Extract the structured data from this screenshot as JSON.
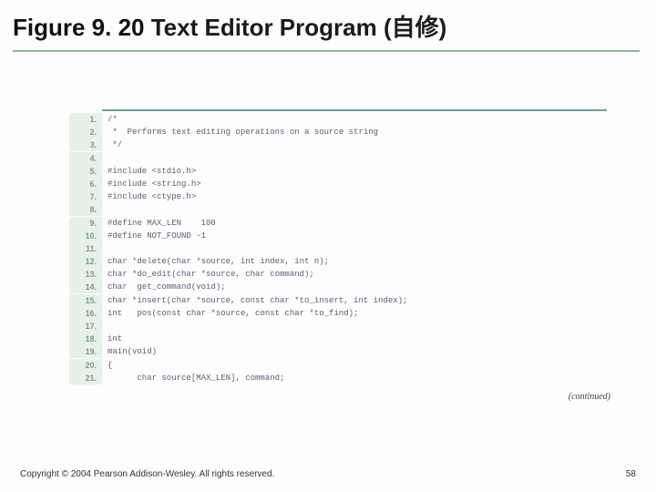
{
  "title": {
    "figure_label": "Figure 9. 20",
    "caption": "  Text Editor Program (自修)"
  },
  "code": {
    "lines": [
      "/*",
      " *  Performs text editing operations on a source string",
      " */",
      "",
      "#include <stdio.h>",
      "#include <string.h>",
      "#include <ctype.h>",
      "",
      "#define MAX_LEN    100",
      "#define NOT_FOUND -1",
      "",
      "char *delete(char *source, int index, int n);",
      "char *do_edit(char *source, char command);",
      "char  get_command(void);",
      "char *insert(char *source, const char *to_insert, int index);",
      "int   pos(const char *source, const char *to_find);",
      "",
      "int",
      "main(void)",
      "{",
      "      char source[MAX_LEN], command;"
    ],
    "line_numbers": [
      "1.",
      "2.",
      "3.",
      "4.",
      "5.",
      "6.",
      "7.",
      "8.",
      "9.",
      "10.",
      "11.",
      "12.",
      "13.",
      "14.",
      "15.",
      "16.",
      "17.",
      "18.",
      "19.",
      "20.",
      "21."
    ]
  },
  "continued": "(continued)",
  "footer": "Copyright © 2004 Pearson Addison-Wesley. All rights reserved.",
  "page_number": "58"
}
